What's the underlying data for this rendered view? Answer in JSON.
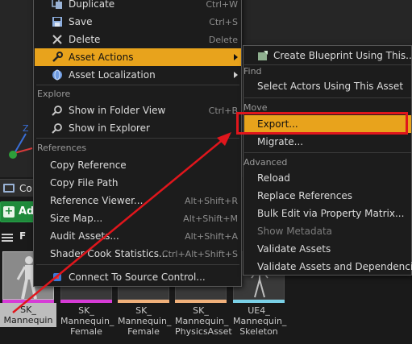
{
  "colors": {
    "menu_bg": "#1c1c1c",
    "highlight": "#e8a31c",
    "annotation_red": "#e0161c",
    "add_green": "#1f8a3b"
  },
  "background": {
    "content_browser_tab": "Co",
    "add_button": "Ad",
    "filter_label": "F"
  },
  "assets": [
    {
      "name": "SK_\nMannequin",
      "strip_color": "#d63bd6"
    },
    {
      "name": "SK_\nMannequin_\nFemale",
      "strip_color": "#d63bd6"
    },
    {
      "name": "SK_\nMannequin_\nFemale",
      "strip_color": "#f0b07a"
    },
    {
      "name": "SK_\nMannequin_\nPhysicsAsset",
      "strip_color": "#f0b07a"
    },
    {
      "name": "UE4_\nMannequin_\nSkeleton",
      "strip_color": "#7ad0e6"
    }
  ],
  "main_menu": {
    "items_top": [
      {
        "label": "Duplicate",
        "shortcut": "Ctrl+W",
        "icon": "duplicate-icon"
      },
      {
        "label": "Save",
        "shortcut": "Ctrl+S",
        "icon": "save-icon"
      },
      {
        "label": "Delete",
        "shortcut": "Delete",
        "icon": "delete-icon"
      },
      {
        "label": "Asset Actions",
        "icon": "wrench-icon"
      },
      {
        "label": "Asset Localization",
        "icon": "globe-icon"
      }
    ],
    "explore_header": "Explore",
    "explore_items": [
      {
        "label": "Show in Folder View",
        "shortcut": "Ctrl+B",
        "icon": "search-icon"
      },
      {
        "label": "Show in Explorer",
        "icon": "search-icon"
      }
    ],
    "references_header": "References",
    "reference_items": [
      {
        "label": "Copy Reference"
      },
      {
        "label": "Copy File Path"
      },
      {
        "label": "Reference Viewer...",
        "shortcut": "Alt+Shift+R"
      },
      {
        "label": "Size Map...",
        "shortcut": "Alt+Shift+M"
      },
      {
        "label": "Audit Assets...",
        "shortcut": "Alt+Shift+A"
      },
      {
        "label": "Shader Cook Statistics...",
        "shortcut": "Ctrl+Alt+Shift+S"
      }
    ],
    "source_control": {
      "label": "Connect To Source Control...",
      "icon": "source-control-icon"
    }
  },
  "sub_menu": {
    "create_blueprint": "Create Blueprint Using This...",
    "find_header": "Find",
    "select_actors": "Select Actors Using This Asset",
    "move_header": "Move",
    "export": "Export...",
    "migrate": "Migrate...",
    "advanced_header": "Advanced",
    "reload": "Reload",
    "replace_references": "Replace References",
    "bulk_edit": "Bulk Edit via Property Matrix...",
    "show_metadata": "Show Metadata",
    "validate_assets": "Validate Assets",
    "validate_deps": "Validate Assets and Dependencies"
  }
}
